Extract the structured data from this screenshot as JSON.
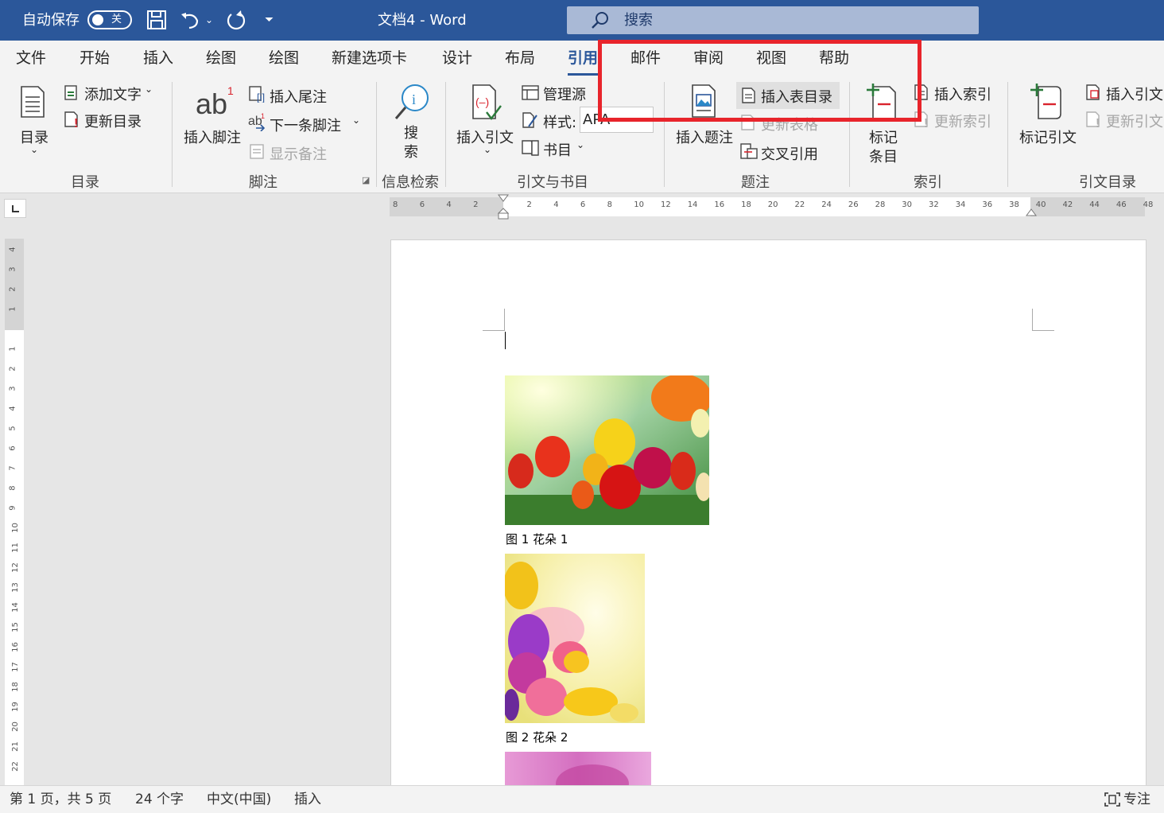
{
  "titlebar": {
    "autosave_label": "自动保存",
    "autosave_state": "关",
    "doc_title": "文档4  -  Word",
    "search_placeholder": "搜索"
  },
  "tabs": [
    "文件",
    "开始",
    "插入",
    "绘图",
    "绘图",
    "新建选项卡",
    "设计",
    "布局",
    "引用",
    "邮件",
    "审阅",
    "视图",
    "帮助"
  ],
  "active_tab": "引用",
  "ribbon": {
    "toc": {
      "big": "目录",
      "add_text": "添加文字",
      "update": "更新目录",
      "group": "目录"
    },
    "footnotes": {
      "big": "插入脚注",
      "endnote": "插入尾注",
      "next": "下一条脚注",
      "show": "显示备注",
      "group": "脚注"
    },
    "research": {
      "big_1": "搜",
      "big_2": "索",
      "group": "信息检索"
    },
    "citations": {
      "big": "插入引文",
      "manage": "管理源",
      "style_label": "样式:",
      "style_value": "APA",
      "biblio": "书目",
      "group": "引文与书目"
    },
    "captions": {
      "big": "插入题注",
      "tof": "插入表目录",
      "update_table": "更新表格",
      "cross_ref": "交叉引用",
      "group": "题注"
    },
    "index": {
      "big_1": "标记",
      "big_2": "条目",
      "insert": "插入索引",
      "update": "更新索引",
      "group": "索引"
    },
    "toa": {
      "big": "标记引文",
      "insert": "插入引文",
      "update": "更新引文",
      "group": "引文目录"
    }
  },
  "ruler": {
    "h_labels": [
      "8",
      "6",
      "4",
      "2",
      "",
      "2",
      "4",
      "6",
      "8",
      "10",
      "12",
      "14",
      "16",
      "18",
      "20",
      "22",
      "24",
      "26",
      "28",
      "30",
      "32",
      "34",
      "36",
      "38",
      "40",
      "42",
      "44",
      "46",
      "48"
    ],
    "v_labels": [
      "4",
      "3",
      "2",
      "1",
      "",
      "1",
      "2",
      "3",
      "4",
      "5",
      "6",
      "7",
      "8",
      "9",
      "10",
      "11",
      "12",
      "13",
      "14",
      "15",
      "16",
      "17",
      "18",
      "19",
      "20",
      "21",
      "22"
    ]
  },
  "document": {
    "captions": [
      "图 1 花朵 1",
      "图 2 花朵 2"
    ]
  },
  "statusbar": {
    "page": "第 1 页，共 5 页",
    "words": "24 个字",
    "language": "中文(中国)",
    "mode": "插入",
    "focus": "专注"
  }
}
